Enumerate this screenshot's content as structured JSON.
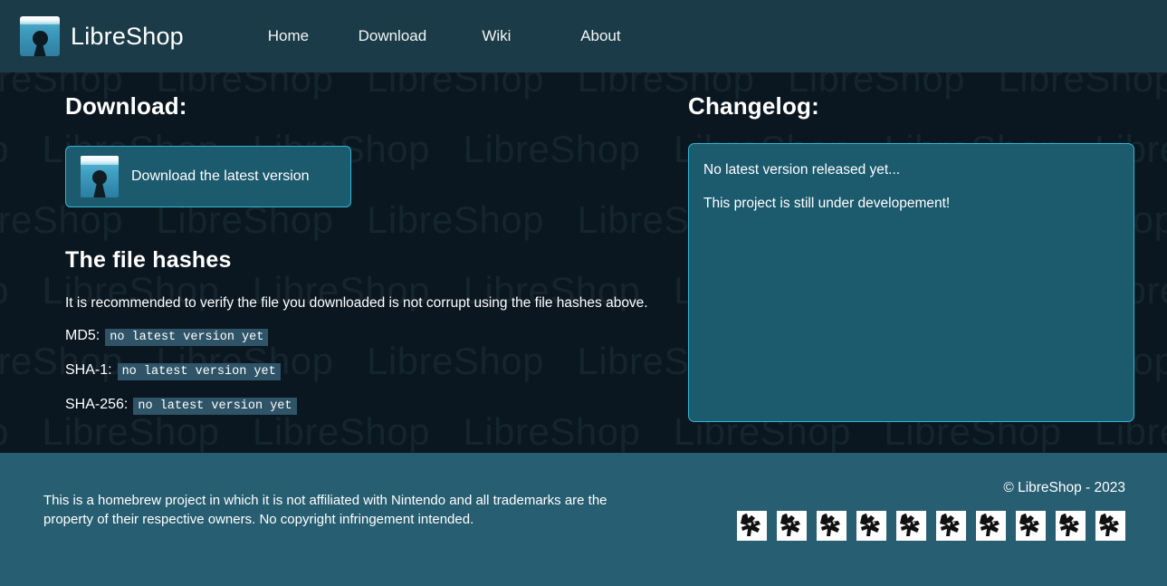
{
  "header": {
    "brand_name": "LibreShop",
    "logo_icon": "keyhole-logo-icon",
    "nav": [
      {
        "label": "Home"
      },
      {
        "label": "Download"
      },
      {
        "label": "Wiki"
      },
      {
        "label": "About"
      }
    ]
  },
  "main": {
    "download": {
      "heading": "Download:",
      "button_label": "Download the latest version",
      "button_icon": "keyhole-logo-icon"
    },
    "hashes": {
      "heading": "The file hashes",
      "note": "It is recommended to verify the file you downloaded is not corrupt using the file hashes above.",
      "rows": [
        {
          "label": "MD5:",
          "value": "no latest version yet"
        },
        {
          "label": "SHA-1:",
          "value": "no latest version yet"
        },
        {
          "label": "SHA-256:",
          "value": "no latest version yet"
        }
      ]
    },
    "changelog": {
      "heading": "Changelog:",
      "lines": [
        "No latest version released yet...",
        "This project is still under developement!"
      ]
    }
  },
  "footer": {
    "disclaimer": "This is a homebrew project in which it is not affiliated with Nintendo and all trademarks are the property of their respective owners. No copyright infringement intended.",
    "copyright": "© LibreShop - 2023",
    "social_icon_count": 10,
    "social_icon_name": "broken-image-placeholder-icon"
  },
  "watermark": {
    "text": "LibreShop"
  },
  "colors": {
    "header_bg": "#1a3b47",
    "body_bg": "#0b1720",
    "footer_bg": "#275e71",
    "panel_bg": "#1c5a6d",
    "panel_border": "#31b5d6",
    "code_bg": "#2f5468",
    "watermark": "#16242e",
    "text": "#ffffff"
  }
}
